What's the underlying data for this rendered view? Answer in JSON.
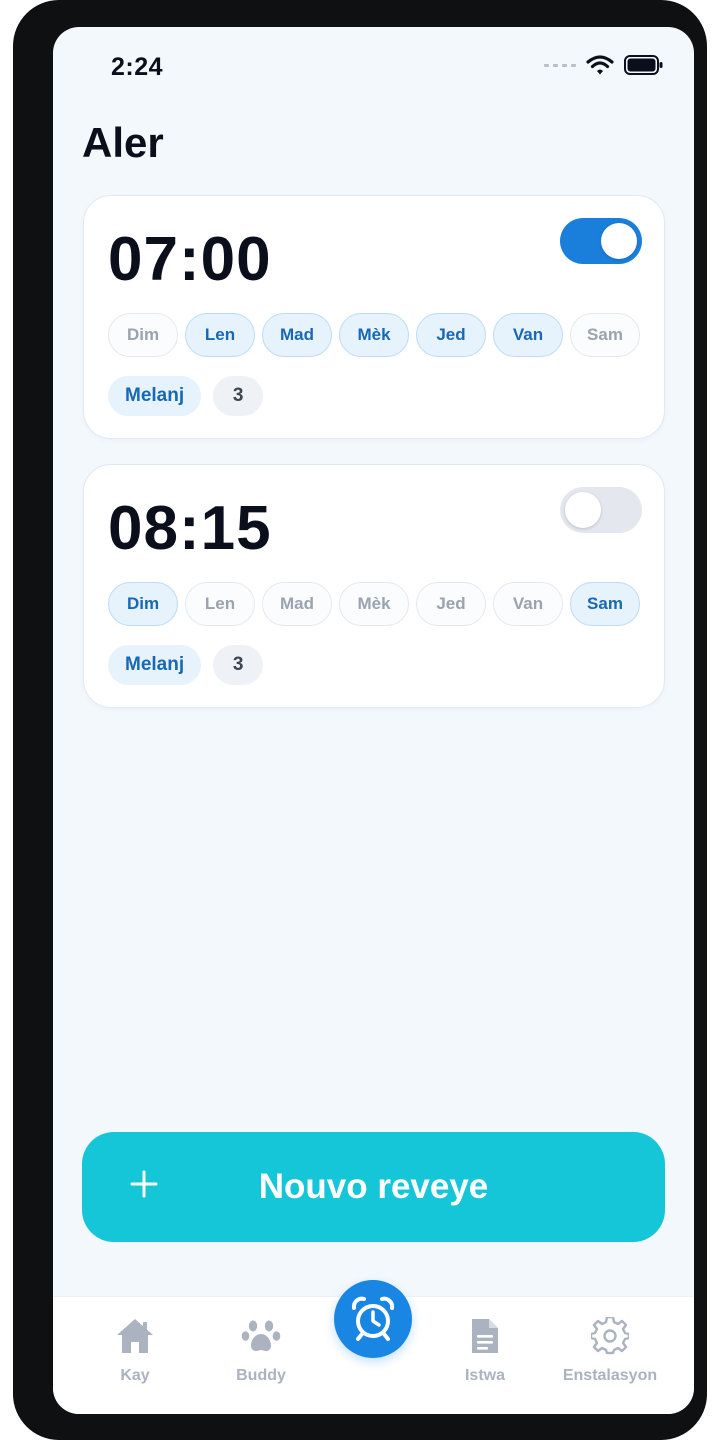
{
  "status_bar": {
    "time": "2:24"
  },
  "page": {
    "title": "Aler"
  },
  "alarms": [
    {
      "time": "07:00",
      "enabled": true,
      "days": [
        {
          "label": "Dim",
          "active": false
        },
        {
          "label": "Len",
          "active": true
        },
        {
          "label": "Mad",
          "active": true
        },
        {
          "label": "Mèk",
          "active": true
        },
        {
          "label": "Jed",
          "active": true
        },
        {
          "label": "Van",
          "active": true
        },
        {
          "label": "Sam",
          "active": false
        }
      ],
      "sound": "Melanj",
      "count": "3"
    },
    {
      "time": "08:15",
      "enabled": false,
      "days": [
        {
          "label": "Dim",
          "active": true
        },
        {
          "label": "Len",
          "active": false
        },
        {
          "label": "Mad",
          "active": false
        },
        {
          "label": "Mèk",
          "active": false
        },
        {
          "label": "Jed",
          "active": false
        },
        {
          "label": "Van",
          "active": false
        },
        {
          "label": "Sam",
          "active": true
        }
      ],
      "sound": "Melanj",
      "count": "3"
    }
  ],
  "new_alarm_button": {
    "label": "Nouvo reveye",
    "icon": "plus-icon"
  },
  "tab_bar": {
    "items": [
      {
        "label": "Kay",
        "icon": "home-icon"
      },
      {
        "label": "Buddy",
        "icon": "paw-icon"
      },
      {
        "label": "",
        "icon": "alarm-clock-icon",
        "selected": true
      },
      {
        "label": "Istwa",
        "icon": "document-icon"
      },
      {
        "label": "Enstalasyon",
        "icon": "gear-icon"
      }
    ]
  },
  "colors": {
    "accent": "#1a7fdb",
    "button": "#15c6d9",
    "background": "#f3f8fd",
    "text": "#0b0f1c"
  }
}
